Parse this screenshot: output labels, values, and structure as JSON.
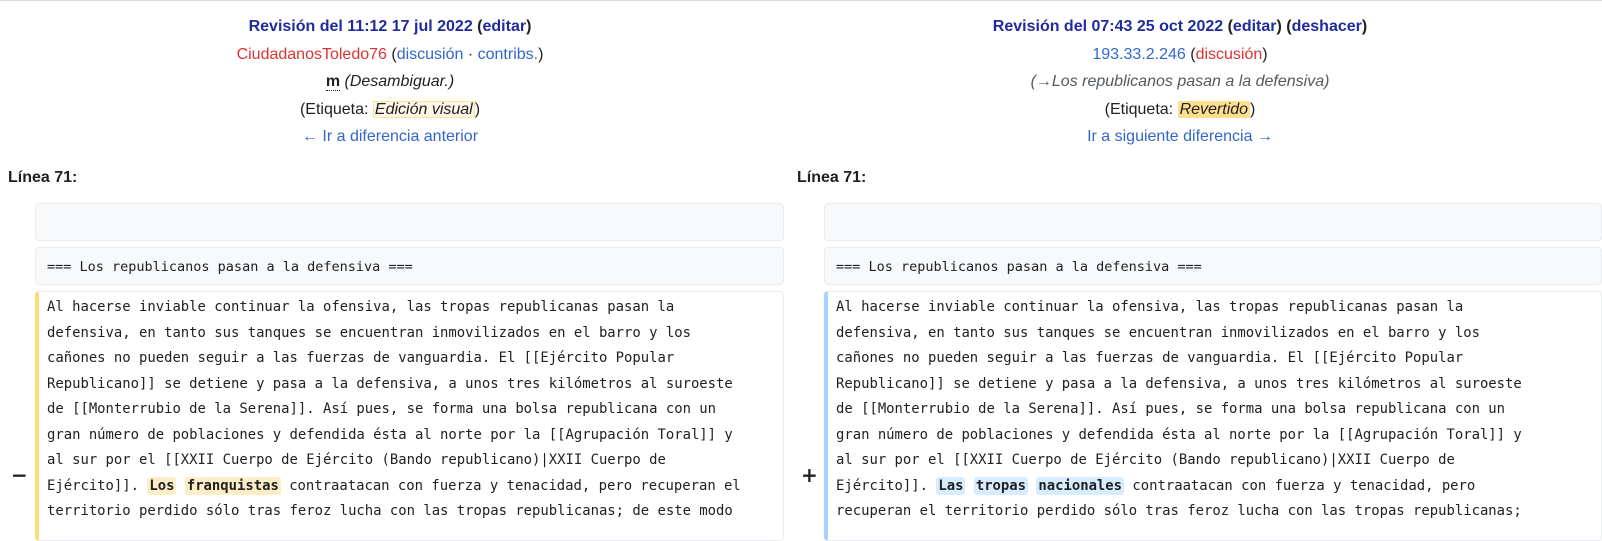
{
  "left": {
    "header": {
      "revision": "Revisión del 11:12 17 jul 2022",
      "edit_link": "editar",
      "user": "CiudadanosToledo76",
      "talk_link": "discusión",
      "separator": "·",
      "contribs_link": "contribs.",
      "minor_flag": "m",
      "summary": "(Desambiguar.)",
      "tag_prefix": "(Etiqueta: ",
      "tag": "Edición visual",
      "tag_suffix": ")",
      "nav_link": "← Ir a diferencia anterior"
    },
    "line_label": "Línea 71:",
    "context_heading": "=== Los republicanos pasan a la defensiva ===",
    "marker": "−",
    "lines": [
      "Al hacerse inviable continuar la ofensiva, las tropas republicanas pasan la",
      "defensiva, en tanto sus tanques se encuentran inmovilizados en el barro y los",
      "cañones no pueden seguir a las fuerzas de vanguardia. El [[Ejército Popular",
      "Republicano]] se detiene y pasa a la defensiva, a unos tres kilómetros al suroeste",
      "de [[Monterrubio de la Serena]]. Así pues, se forma una bolsa republicana con un",
      "gran número de poblaciones y defendida ésta al norte por la [[Agrupación Toral]] y",
      "al sur por el [[XXII Cuerpo de Ejército (Bando republicano)|XXII Cuerpo de"
    ],
    "line8_pre": "Ejército]]. ",
    "line8_w1": "Los",
    "line8_w2": "franquistas",
    "line8_post": " contraatacan con fuerza y tenacidad, pero recuperan el",
    "line9": "territorio perdido sólo tras feroz lucha con las tropas republicanas; de este modo"
  },
  "right": {
    "header": {
      "revision": "Revisión del 07:43 25 oct 2022",
      "edit_link": "editar",
      "undo_link": "deshacer",
      "user": "193.33.2.246",
      "talk_link": "discusión",
      "summary": "(→Los republicanos pasan a la defensiva)",
      "tag_prefix": "(Etiqueta: ",
      "tag": "Revertido",
      "tag_suffix": ")",
      "nav_link": "Ir a siguiente diferencia →"
    },
    "line_label": "Línea 71:",
    "context_heading": "=== Los republicanos pasan a la defensiva ===",
    "marker": "+",
    "lines": [
      "Al hacerse inviable continuar la ofensiva, las tropas republicanas pasan la",
      "defensiva, en tanto sus tanques se encuentran inmovilizados en el barro y los",
      "cañones no pueden seguir a las fuerzas de vanguardia. El [[Ejército Popular",
      "Republicano]] se detiene y pasa a la defensiva, a unos tres kilómetros al suroeste",
      "de [[Monterrubio de la Serena]]. Así pues, se forma una bolsa republicana con un",
      "gran número de poblaciones y defendida ésta al norte por la [[Agrupación Toral]] y",
      "al sur por el [[XXII Cuerpo de Ejército (Bando republicano)|XXII Cuerpo de"
    ],
    "line8_pre": "Ejército]]. ",
    "line8_w1": "Las",
    "line8_w2": "tropas",
    "line8_w3": "nacionales",
    "line8_post": " contraatacan con fuerza y tenacidad, pero",
    "line9": "recuperan el territorio perdido sólo tras feroz lucha con las tropas republicanas;"
  }
}
